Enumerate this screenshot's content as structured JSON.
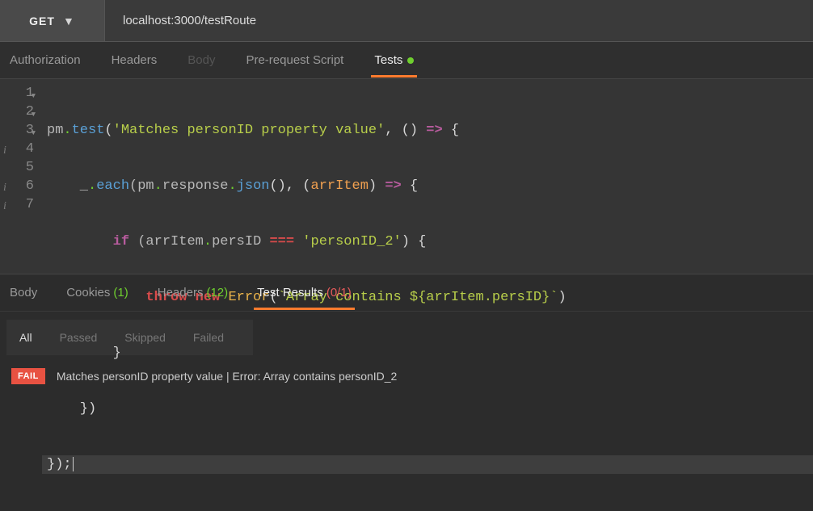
{
  "method": "GET",
  "url": "localhost:3000/testRoute",
  "upperTabs": {
    "authorization": "Authorization",
    "headers": "Headers",
    "body": "Body",
    "prerequest": "Pre-request Script",
    "tests": "Tests"
  },
  "code": {
    "l1a": "pm",
    "l1b": ".",
    "l1c": "test",
    "l1d": "(",
    "l1e": "'Matches personID property value'",
    "l1f": ", () ",
    "l1g": "=>",
    "l1h": " {",
    "l2a": "    _",
    "l2b": ".",
    "l2c": "each",
    "l2d": "(pm",
    "l2e": ".",
    "l2f": "response",
    "l2g": ".",
    "l2h": "json",
    "l2i": "(), (",
    "l2j": "arrItem",
    "l2k": ") ",
    "l2l": "=>",
    "l2m": " {",
    "l3a": "        ",
    "l3b": "if",
    "l3c": " (arrItem",
    "l3d": ".",
    "l3e": "persID ",
    "l3f": "===",
    "l3g": " ",
    "l3h": "'personID_2'",
    "l3i": ") {",
    "l4a": "            ",
    "l4b": "throw",
    "l4c": " ",
    "l4d": "new",
    "l4e": " ",
    "l4f": "Error",
    "l4g": "(",
    "l4h": "`Array contains ${arrItem.persID}`",
    "l4i": ")",
    "l5a": "        }",
    "l6a": "    })",
    "l7a": "});"
  },
  "respTabs": {
    "body": "Body",
    "cookies": "Cookies",
    "cookiesCount": "(1)",
    "headers": "Headers",
    "headersCount": "(12)",
    "testResults": "Test Results",
    "testResultsCount": "(0/1)"
  },
  "filters": {
    "all": "All",
    "passed": "Passed",
    "skipped": "Skipped",
    "failed": "Failed"
  },
  "result": {
    "badge": "FAIL",
    "text": "Matches personID property value | Error: Array contains personID_2"
  },
  "gutter": [
    "1",
    "2",
    "3",
    "4",
    "5",
    "6",
    "7"
  ]
}
